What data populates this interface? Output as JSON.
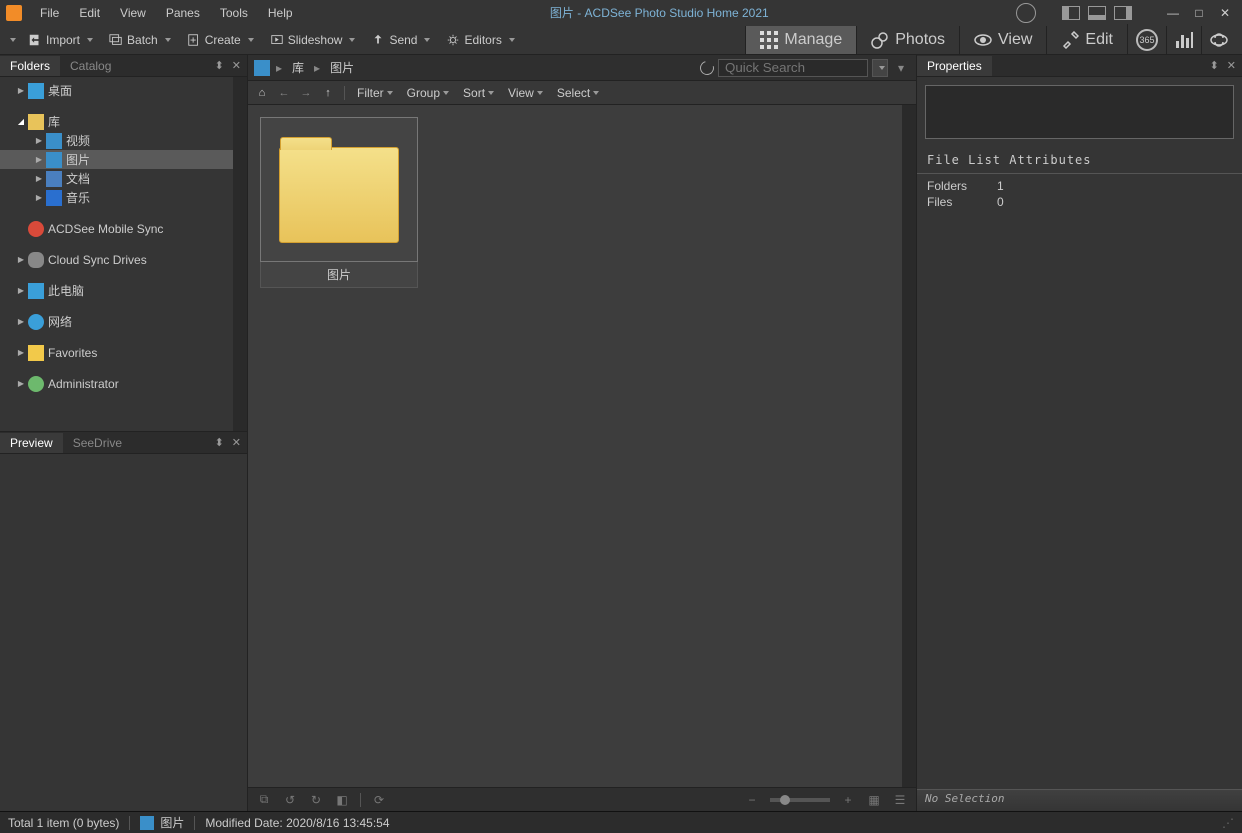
{
  "titlebar": {
    "title": "图片 - ACDSee Photo Studio Home 2021",
    "menus": [
      "File",
      "Edit",
      "View",
      "Panes",
      "Tools",
      "Help"
    ]
  },
  "toolbar": {
    "import": "Import",
    "batch": "Batch",
    "create": "Create",
    "slideshow": "Slideshow",
    "send": "Send",
    "editors": "Editors"
  },
  "modes": {
    "manage": "Manage",
    "photos": "Photos",
    "view": "View",
    "edit": "Edit",
    "365": "365"
  },
  "folders_panel": {
    "tab_folders": "Folders",
    "tab_catalog": "Catalog",
    "items": {
      "desktop": "桌面",
      "library": "库",
      "videos": "视频",
      "pictures": "图片",
      "documents": "文档",
      "music": "音乐",
      "mobile_sync": "ACDSee Mobile Sync",
      "cloud_drives": "Cloud Sync Drives",
      "this_pc": "此电脑",
      "network": "网络",
      "favorites": "Favorites",
      "administrator": "Administrator"
    }
  },
  "preview_panel": {
    "tab_preview": "Preview",
    "tab_seedrive": "SeeDrive"
  },
  "breadcrumb": {
    "root": "库",
    "current": "图片"
  },
  "search": {
    "placeholder": "Quick Search"
  },
  "navbar": {
    "filter": "Filter",
    "group": "Group",
    "sort": "Sort",
    "view": "View",
    "select": "Select"
  },
  "content": {
    "folder1_label": "图片"
  },
  "properties": {
    "title": "Properties",
    "attrs_header": "File List Attributes",
    "folders_key": "Folders",
    "folders_val": "1",
    "files_key": "Files",
    "files_val": "0",
    "footer": "No Selection"
  },
  "statusbar": {
    "total": "Total 1 item  (0 bytes)",
    "name": "图片",
    "modified": "Modified Date: 2020/8/16 13:45:54"
  }
}
